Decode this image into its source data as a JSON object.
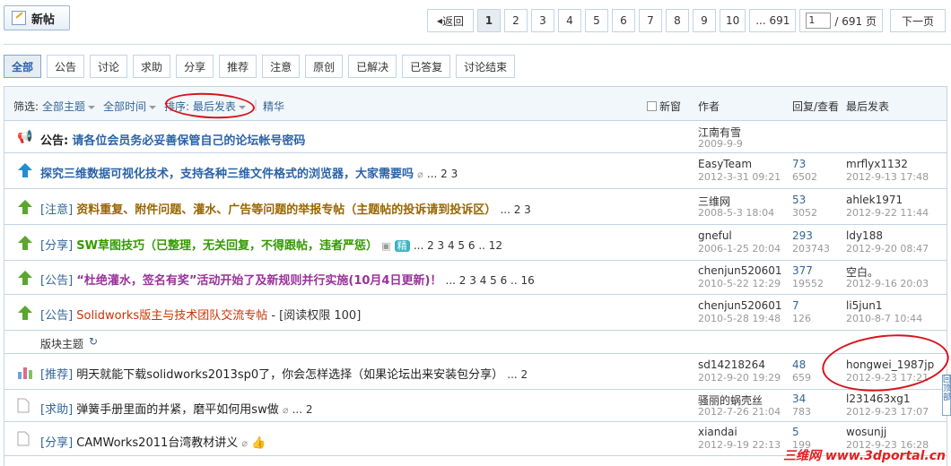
{
  "toolbar": {
    "new_post": "新帖"
  },
  "pager": {
    "back": "返回",
    "pages": [
      "1",
      "2",
      "3",
      "4",
      "5",
      "6",
      "7",
      "8",
      "9",
      "10"
    ],
    "last": "... 691",
    "jump_value": "1",
    "total": "/ 691 页",
    "next": "下一页"
  },
  "tabs": [
    "全部",
    "公告",
    "讨论",
    "求助",
    "分享",
    "推荐",
    "注意",
    "原创",
    "已解决",
    "已答复",
    "讨论结束"
  ],
  "filter": {
    "label": "筛选:",
    "topics": "全部主题",
    "time": "全部时间",
    "sort": "排序: 最后发表",
    "digest": "精华",
    "new_window": "新窗",
    "col_author": "作者",
    "col_replies": "回复/查看",
    "col_last": "最后发表"
  },
  "threads": [
    {
      "prefix": "公告:",
      "title": "请各位会员务必妥善保管自己的论坛帐号密码",
      "pages": "",
      "author": "江南有雪",
      "date": "2009-9-9",
      "replies": "",
      "views": "",
      "last_user": "",
      "last_time": ""
    },
    {
      "prefix": "",
      "title": "探究三维数据可视化技术，支持各种三维文件格式的浏览器，大家需要吗",
      "pages": "... 2  3",
      "author": "EasyTeam",
      "date": "2012-3-31 09:21",
      "replies": "73",
      "views": "6502",
      "last_user": "mrflyx1132",
      "last_time": "2012-9-13 17:48"
    },
    {
      "prefix": "[注意]",
      "title": "资料重复、附件问题、灌水、广告等问题的举报专帖（主题帖的投诉请到投诉区）",
      "pages": "... 2  3",
      "author": "三维网",
      "date": "2008-5-3 18:04",
      "replies": "53",
      "views": "3052",
      "last_user": "ahlek1971",
      "last_time": "2012-9-22 11:44"
    },
    {
      "prefix": "[分享]",
      "title": "SW草图技巧（已整理，无关回复，不得跟帖，违者严惩）",
      "pages": "... 2  3  4  5  6 .. 12",
      "author": "gneful",
      "date": "2006-1-25 20:04",
      "replies": "293",
      "views": "203743",
      "last_user": "ldy188",
      "last_time": "2012-9-20 08:47"
    },
    {
      "prefix": "[公告]",
      "title": "“杜绝灌水，签名有奖”活动开始了及新规则并行实施(10月4日更新)！",
      "pages": "... 2  3  4  5  6 .. 16",
      "author": "chenjun520601",
      "date": "2010-5-22 12:29",
      "replies": "377",
      "views": "19552",
      "last_user": "空白。",
      "last_time": "2012-9-16 20:03"
    },
    {
      "prefix": "[公告]",
      "title": "Solidworks版主与技术团队交流专帖",
      "extra": "- [阅读权限 100]",
      "pages": "",
      "author": "chenjun520601",
      "date": "2010-5-28 19:48",
      "replies": "7",
      "views": "126",
      "last_user": "li5jun1",
      "last_time": "2010-8-7 10:44"
    }
  ],
  "section_label": "版块主题",
  "normal_threads": [
    {
      "prefix": "[推荐]",
      "title": "明天就能下载solidworks2013sp0了，你会怎样选择（如果论坛出来安装包分享）",
      "pages": "... 2",
      "author": "sd14218264",
      "date": "2012-9-20 19:29",
      "replies": "48",
      "views": "659",
      "last_user": "hongwei_1987jp",
      "last_time": "2012-9-23 17:21"
    },
    {
      "prefix": "[求助]",
      "title": "弹簧手册里面的并紧，磨平如何用sw做",
      "pages": "... 2",
      "author": "骚丽的蜗壳丝",
      "date": "2012-7-26 21:04",
      "replies": "34",
      "views": "783",
      "last_user": "l231463xg1",
      "last_time": "2012-9-23 17:07"
    },
    {
      "prefix": "[分享]",
      "title": "CAMWorks2011台湾教材讲义",
      "pages": "",
      "author": "xiandai",
      "date": "2012-9-19 22:13",
      "replies": "5",
      "views": "199",
      "last_user": "wosunjj",
      "last_time": "2012-9-23 16:28"
    }
  ],
  "watermark": "三维网 www.3dportal.cn",
  "side_tab": "回顶部"
}
